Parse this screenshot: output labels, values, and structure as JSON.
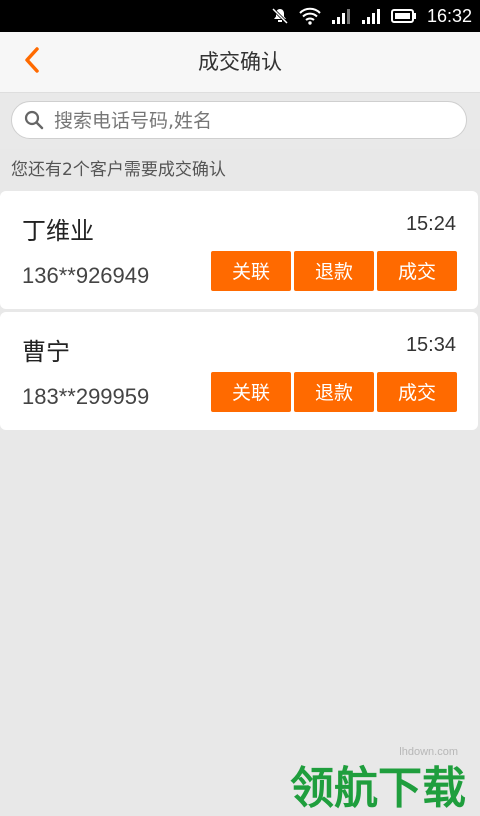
{
  "status_bar": {
    "time": "16:32",
    "icons": [
      "notification-muted-icon",
      "wifi-icon",
      "signal-icon",
      "signal-icon",
      "battery-icon"
    ]
  },
  "header": {
    "title": "成交确认",
    "back_icon": "chevron-left-icon"
  },
  "search": {
    "placeholder": "搜索电话号码,姓名",
    "value": ""
  },
  "notice": "您还有2个客户需要成交确认",
  "customers": [
    {
      "name": "丁维业",
      "time": "15:24",
      "phone": "136**926949",
      "actions": [
        "关联",
        "退款",
        "成交"
      ]
    },
    {
      "name": "曹宁",
      "time": "15:34",
      "phone": "183**299959",
      "actions": [
        "关联",
        "退款",
        "成交"
      ]
    }
  ],
  "colors": {
    "accent": "#ff6a00",
    "background": "#e8e8e8"
  },
  "watermark": {
    "main": "领航下载",
    "small": "lhdown.com"
  }
}
